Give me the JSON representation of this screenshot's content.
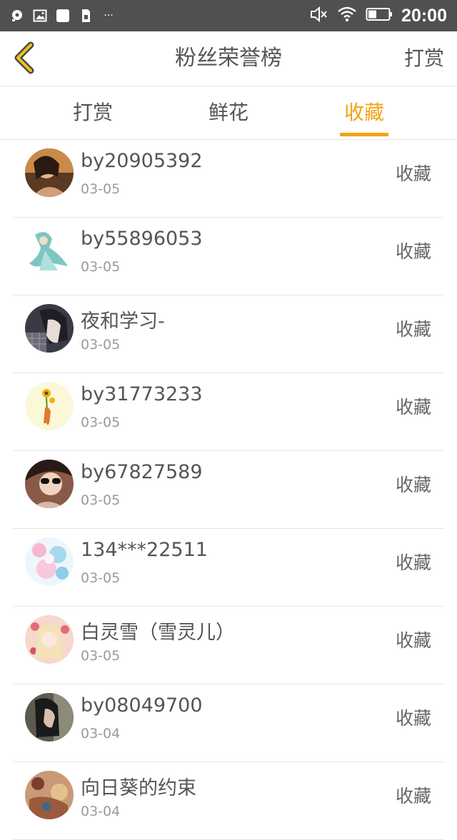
{
  "status_bar": {
    "icons_left": [
      "notification-icon",
      "image-icon",
      "square-icon",
      "sim-icon",
      "more-icon"
    ],
    "more": "···",
    "icons_right": [
      "mute-icon",
      "wifi-icon",
      "battery-icon"
    ],
    "time": "20:00"
  },
  "header": {
    "title": "粉丝荣誉榜",
    "right_action": "打赏",
    "accent_color": "#f3a316"
  },
  "tabs": [
    {
      "label": "打赏",
      "active": false
    },
    {
      "label": "鲜花",
      "active": false
    },
    {
      "label": "收藏",
      "active": true
    }
  ],
  "fans": [
    {
      "name": "by20905392",
      "date": "03-05",
      "action": "收藏"
    },
    {
      "name": "by55896053",
      "date": "03-05",
      "action": "收藏"
    },
    {
      "name": "夜和学习-",
      "date": "03-05",
      "action": "收藏"
    },
    {
      "name": "by31773233",
      "date": "03-05",
      "action": "收藏"
    },
    {
      "name": "by67827589",
      "date": "03-05",
      "action": "收藏"
    },
    {
      "name": "134***22511",
      "date": "03-05",
      "action": "收藏"
    },
    {
      "name": "白灵雪（雪灵儿）",
      "date": "03-05",
      "action": "收藏"
    },
    {
      "name": "by08049700",
      "date": "03-04",
      "action": "收藏"
    },
    {
      "name": "向日葵的约束",
      "date": "03-04",
      "action": "收藏"
    }
  ]
}
